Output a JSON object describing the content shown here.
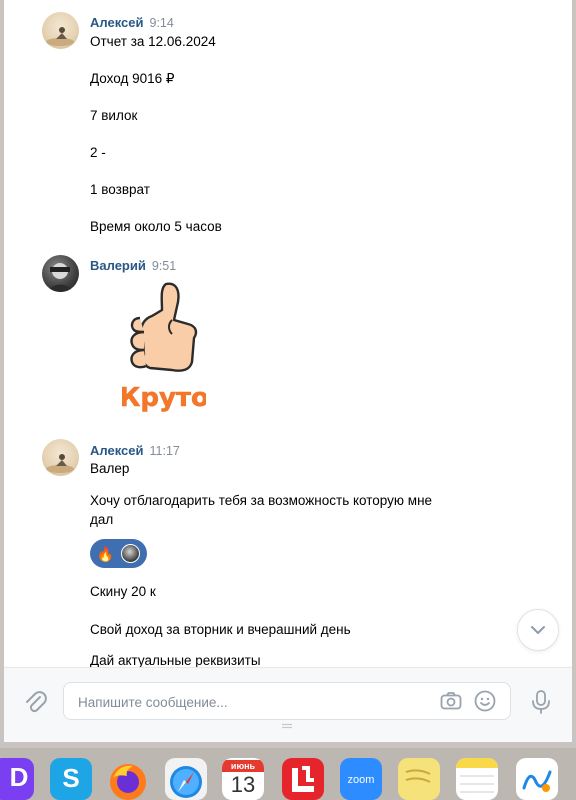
{
  "messages": [
    {
      "author": "Алексей",
      "time": "9:14",
      "lines": [
        "Отчет за 12.06.2024",
        "Доход 9016 ₽",
        "7 вилок",
        "2 -",
        "1 возврат",
        "Время около 5 часов"
      ]
    },
    {
      "author": "Валерий",
      "time": "9:51",
      "sticker": {
        "text": "Круто",
        "icon": "thumbs-up-icon"
      }
    },
    {
      "author": "Алексей",
      "time": "11:17",
      "lines": [
        "Валер",
        "Хочу отблагодарить тебя за возможность которую мне",
        "дал",
        "Скину 20 к",
        "Свой доход за вторник и вчерашний день",
        "Дай актуальные реквизиты"
      ],
      "reaction": {
        "emoji": "🔥",
        "icon": "fire-icon"
      }
    }
  ],
  "composer": {
    "placeholder": "Напишите сообщение..."
  },
  "dock": [
    {
      "name": "D",
      "icon": "d-app-icon",
      "color": "#7b3ff2"
    },
    {
      "name": "S",
      "icon": "skype-icon",
      "color": "#1ea5e5"
    },
    {
      "name": "",
      "icon": "firefox-icon",
      "color": "#ff7a1a"
    },
    {
      "name": "",
      "icon": "safari-icon",
      "color": "#1e88e5"
    },
    {
      "name": "июнь",
      "day": "13",
      "icon": "calendar-icon"
    },
    {
      "name": "",
      "icon": "lcloud-icon",
      "color": "#e6242b"
    },
    {
      "name": "zoom",
      "icon": "zoom-icon",
      "color": "#2d8cff"
    },
    {
      "name": "",
      "icon": "stickies-icon",
      "color": "#f6e27a"
    },
    {
      "name": "",
      "icon": "notes-icon",
      "color": "#f9d949"
    },
    {
      "name": "",
      "icon": "freeform-icon",
      "color": "#ffffff"
    }
  ]
}
